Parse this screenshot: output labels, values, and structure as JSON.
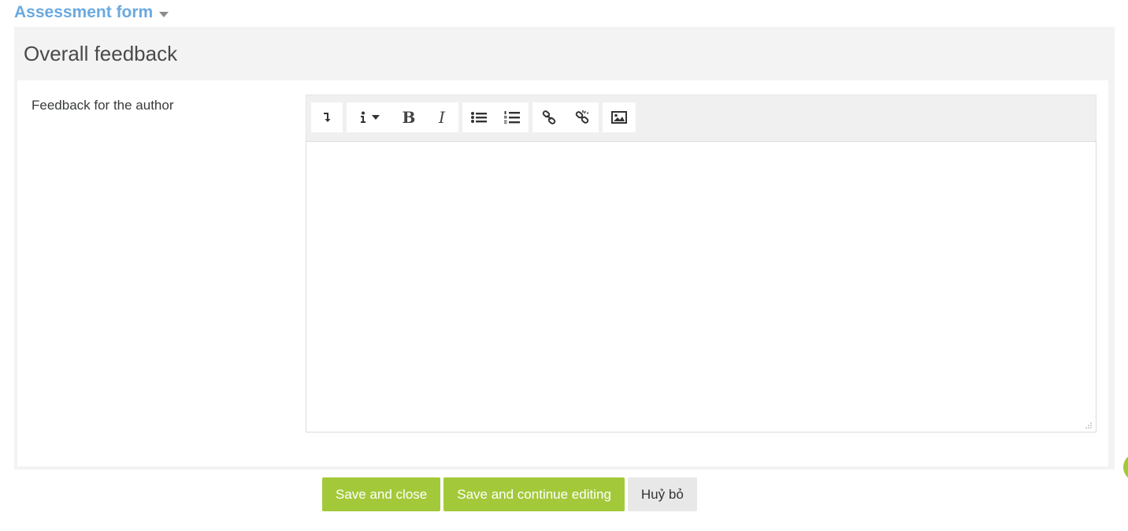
{
  "section": {
    "title": "Assessment form"
  },
  "card": {
    "title": "Overall feedback",
    "field_label": "Feedback for the author"
  },
  "editor": {
    "toolbar": [
      {
        "icon": "collapse-toolbar-icon"
      },
      {
        "icon": "info-dropdown-icon"
      },
      {
        "icon": "bold-icon",
        "text": "B"
      },
      {
        "icon": "italic-icon",
        "text": "I"
      },
      {
        "icon": "unordered-list-icon"
      },
      {
        "icon": "ordered-list-icon"
      },
      {
        "icon": "link-icon"
      },
      {
        "icon": "unlink-icon"
      },
      {
        "icon": "image-icon"
      }
    ],
    "content": ""
  },
  "actions": {
    "save_close": "Save and close",
    "save_continue": "Save and continue editing",
    "cancel": "Huỷ bỏ"
  },
  "colors": {
    "accent": "#a3c93a",
    "link": "#6aa9e0"
  }
}
